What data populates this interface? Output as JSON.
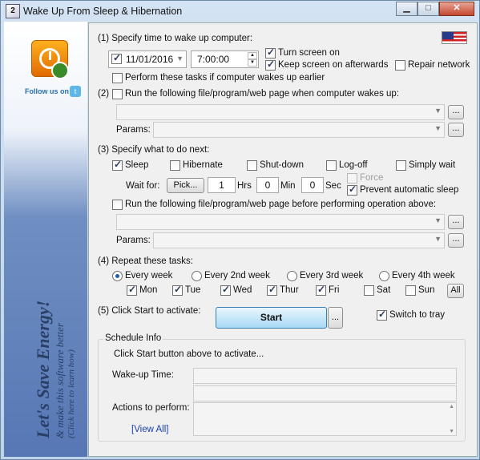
{
  "window": {
    "title": "Wake Up From Sleep & Hibernation",
    "icon_text": "2"
  },
  "sidebar": {
    "follow_text": "Follow us on",
    "banner_line1": "Let's Save Energy!",
    "banner_line2": "& make this software better",
    "banner_line3": "(Click here to learn how)"
  },
  "section1": {
    "label": "(1) Specify time to wake up computer:",
    "date_value": "11/01/2016",
    "date_checked": true,
    "time_value": "7:00:00",
    "turn_screen_on": {
      "label": "Turn screen on",
      "checked": true
    },
    "keep_screen_on": {
      "label": "Keep screen on afterwards",
      "checked": true
    },
    "repair_network": {
      "label": "Repair network",
      "checked": false
    },
    "perform_earlier": {
      "label": "Perform these tasks if computer wakes up earlier",
      "checked": false
    }
  },
  "section2": {
    "label": "Run the following file/program/web page when computer wakes up:",
    "prefix": "(2)",
    "checked": false,
    "file_value": "",
    "params_label": "Params:",
    "params_value": "",
    "browse_label": "..."
  },
  "section3": {
    "label": "(3) Specify what to do next:",
    "options": [
      {
        "label": "Sleep",
        "checked": true
      },
      {
        "label": "Hibernate",
        "checked": false
      },
      {
        "label": "Shut-down",
        "checked": false
      },
      {
        "label": "Log-off",
        "checked": false
      },
      {
        "label": "Simply wait",
        "checked": false
      }
    ],
    "wait_for_label": "Wait for:",
    "pick_label": "Pick...",
    "hrs_value": "1",
    "hrs_label": "Hrs",
    "min_value": "0",
    "min_label": "Min",
    "sec_value": "0",
    "sec_label": "Sec",
    "force": {
      "label": "Force",
      "checked": false
    },
    "prevent_sleep": {
      "label": "Prevent automatic sleep",
      "checked": true
    },
    "run_before": {
      "label": "Run the following file/program/web page before performing operation above:",
      "checked": false
    },
    "params_label": "Params:",
    "browse_label": "..."
  },
  "section4": {
    "label": "(4) Repeat these tasks:",
    "frequencies": [
      {
        "label": "Every week",
        "selected": true
      },
      {
        "label": "Every 2nd week",
        "selected": false
      },
      {
        "label": "Every 3rd week",
        "selected": false
      },
      {
        "label": "Every 4th week",
        "selected": false
      }
    ],
    "days": [
      {
        "label": "Mon",
        "checked": true
      },
      {
        "label": "Tue",
        "checked": true
      },
      {
        "label": "Wed",
        "checked": true
      },
      {
        "label": "Thur",
        "checked": true
      },
      {
        "label": "Fri",
        "checked": true
      },
      {
        "label": "Sat",
        "checked": false
      },
      {
        "label": "Sun",
        "checked": false
      }
    ],
    "all_label": "All"
  },
  "section5": {
    "label": "(5) Click Start to activate:",
    "start_label": "Start",
    "more_label": "...",
    "switch_to_tray": {
      "label": "Switch to tray",
      "checked": true
    }
  },
  "schedule": {
    "title": "Schedule Info",
    "status": "Click Start button above to activate...",
    "wakeup_label": "Wake-up Time:",
    "actions_label": "Actions to perform:",
    "view_all": "[View All]"
  }
}
